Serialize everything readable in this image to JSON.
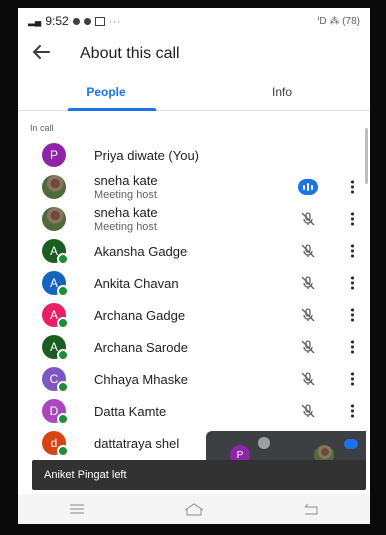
{
  "status": {
    "time": "9:52",
    "ellipsis": "···",
    "right": "ᑊD ⁂ (78)"
  },
  "header": {
    "title": "About this call"
  },
  "tabs": [
    {
      "label": "People"
    },
    {
      "label": "Info"
    }
  ],
  "section_label": "In call",
  "participants": [
    {
      "name": "Priya diwate (You)",
      "initial": "P",
      "color": "#8e24aa"
    },
    {
      "name": "sneha kate",
      "sub": "Meeting host",
      "photo": true,
      "mic": "speaking"
    },
    {
      "name": "sneha kate",
      "sub": "Meeting host",
      "photo": true,
      "mic": "muted"
    },
    {
      "name": "Akansha Gadge",
      "initial": "A",
      "color": "#1b5e20",
      "mic": "muted"
    },
    {
      "name": "Ankita Chavan",
      "initial": "A",
      "color": "#1565c0",
      "mic": "muted"
    },
    {
      "name": "Archana Gadge",
      "initial": "A",
      "color": "#e91e63",
      "mic": "muted"
    },
    {
      "name": "Archana Sarode",
      "initial": "A",
      "color": "#1b5e20",
      "mic": "muted"
    },
    {
      "name": "Chhaya Mhaske",
      "initial": "C",
      "color": "#7e57c2",
      "mic": "muted"
    },
    {
      "name": "Datta Kamte",
      "initial": "D",
      "color": "#ab47bc",
      "mic": "muted"
    },
    {
      "name": "dattatraya shel",
      "initial": "d",
      "color": "#d84315"
    }
  ],
  "pip": {
    "self_initial": "P",
    "self_color": "#8e24aa"
  },
  "toast": {
    "text": "Aniket Pingat left"
  },
  "icons": {
    "back": "back-arrow-icon",
    "mic_muted": "mic-off-icon",
    "mic_on": "mic-speaking-icon",
    "more": "more-vert-icon"
  }
}
